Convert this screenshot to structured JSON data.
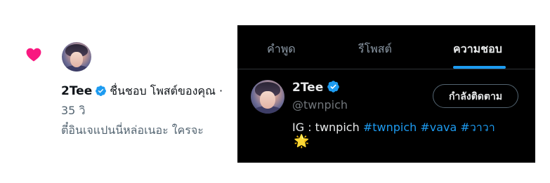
{
  "notification": {
    "user_name": "2Tee",
    "action_text": "ชื่นชอบ โพสต์ของคุณ ·",
    "time": "35 วิ",
    "post_text": "ตี๋อินเจแปนนี่หล่อเนอะ ใครจะ"
  },
  "panel": {
    "tabs": [
      {
        "label": "คำพูด"
      },
      {
        "label": "รีโพสต์"
      },
      {
        "label": "ความชอบ"
      }
    ],
    "active_tab": "ความชอบ",
    "user": {
      "name": "2Tee",
      "handle": "@twnpich",
      "follow_button": "กำลังติดตาม",
      "bio_prefix": "IG : twnpich",
      "bio_tags": [
        "#twnpich",
        "#vava",
        "#วาวา"
      ],
      "bio_emoji": "🌟"
    }
  },
  "colors": {
    "heart": "#f91880",
    "verified": "#1d9bf0",
    "link": "#1d9bf0",
    "panel_bg": "#000000"
  },
  "icons": {
    "heart": "heart-icon",
    "verified": "verified-badge-icon",
    "emoji": "glowing-star-emoji"
  }
}
